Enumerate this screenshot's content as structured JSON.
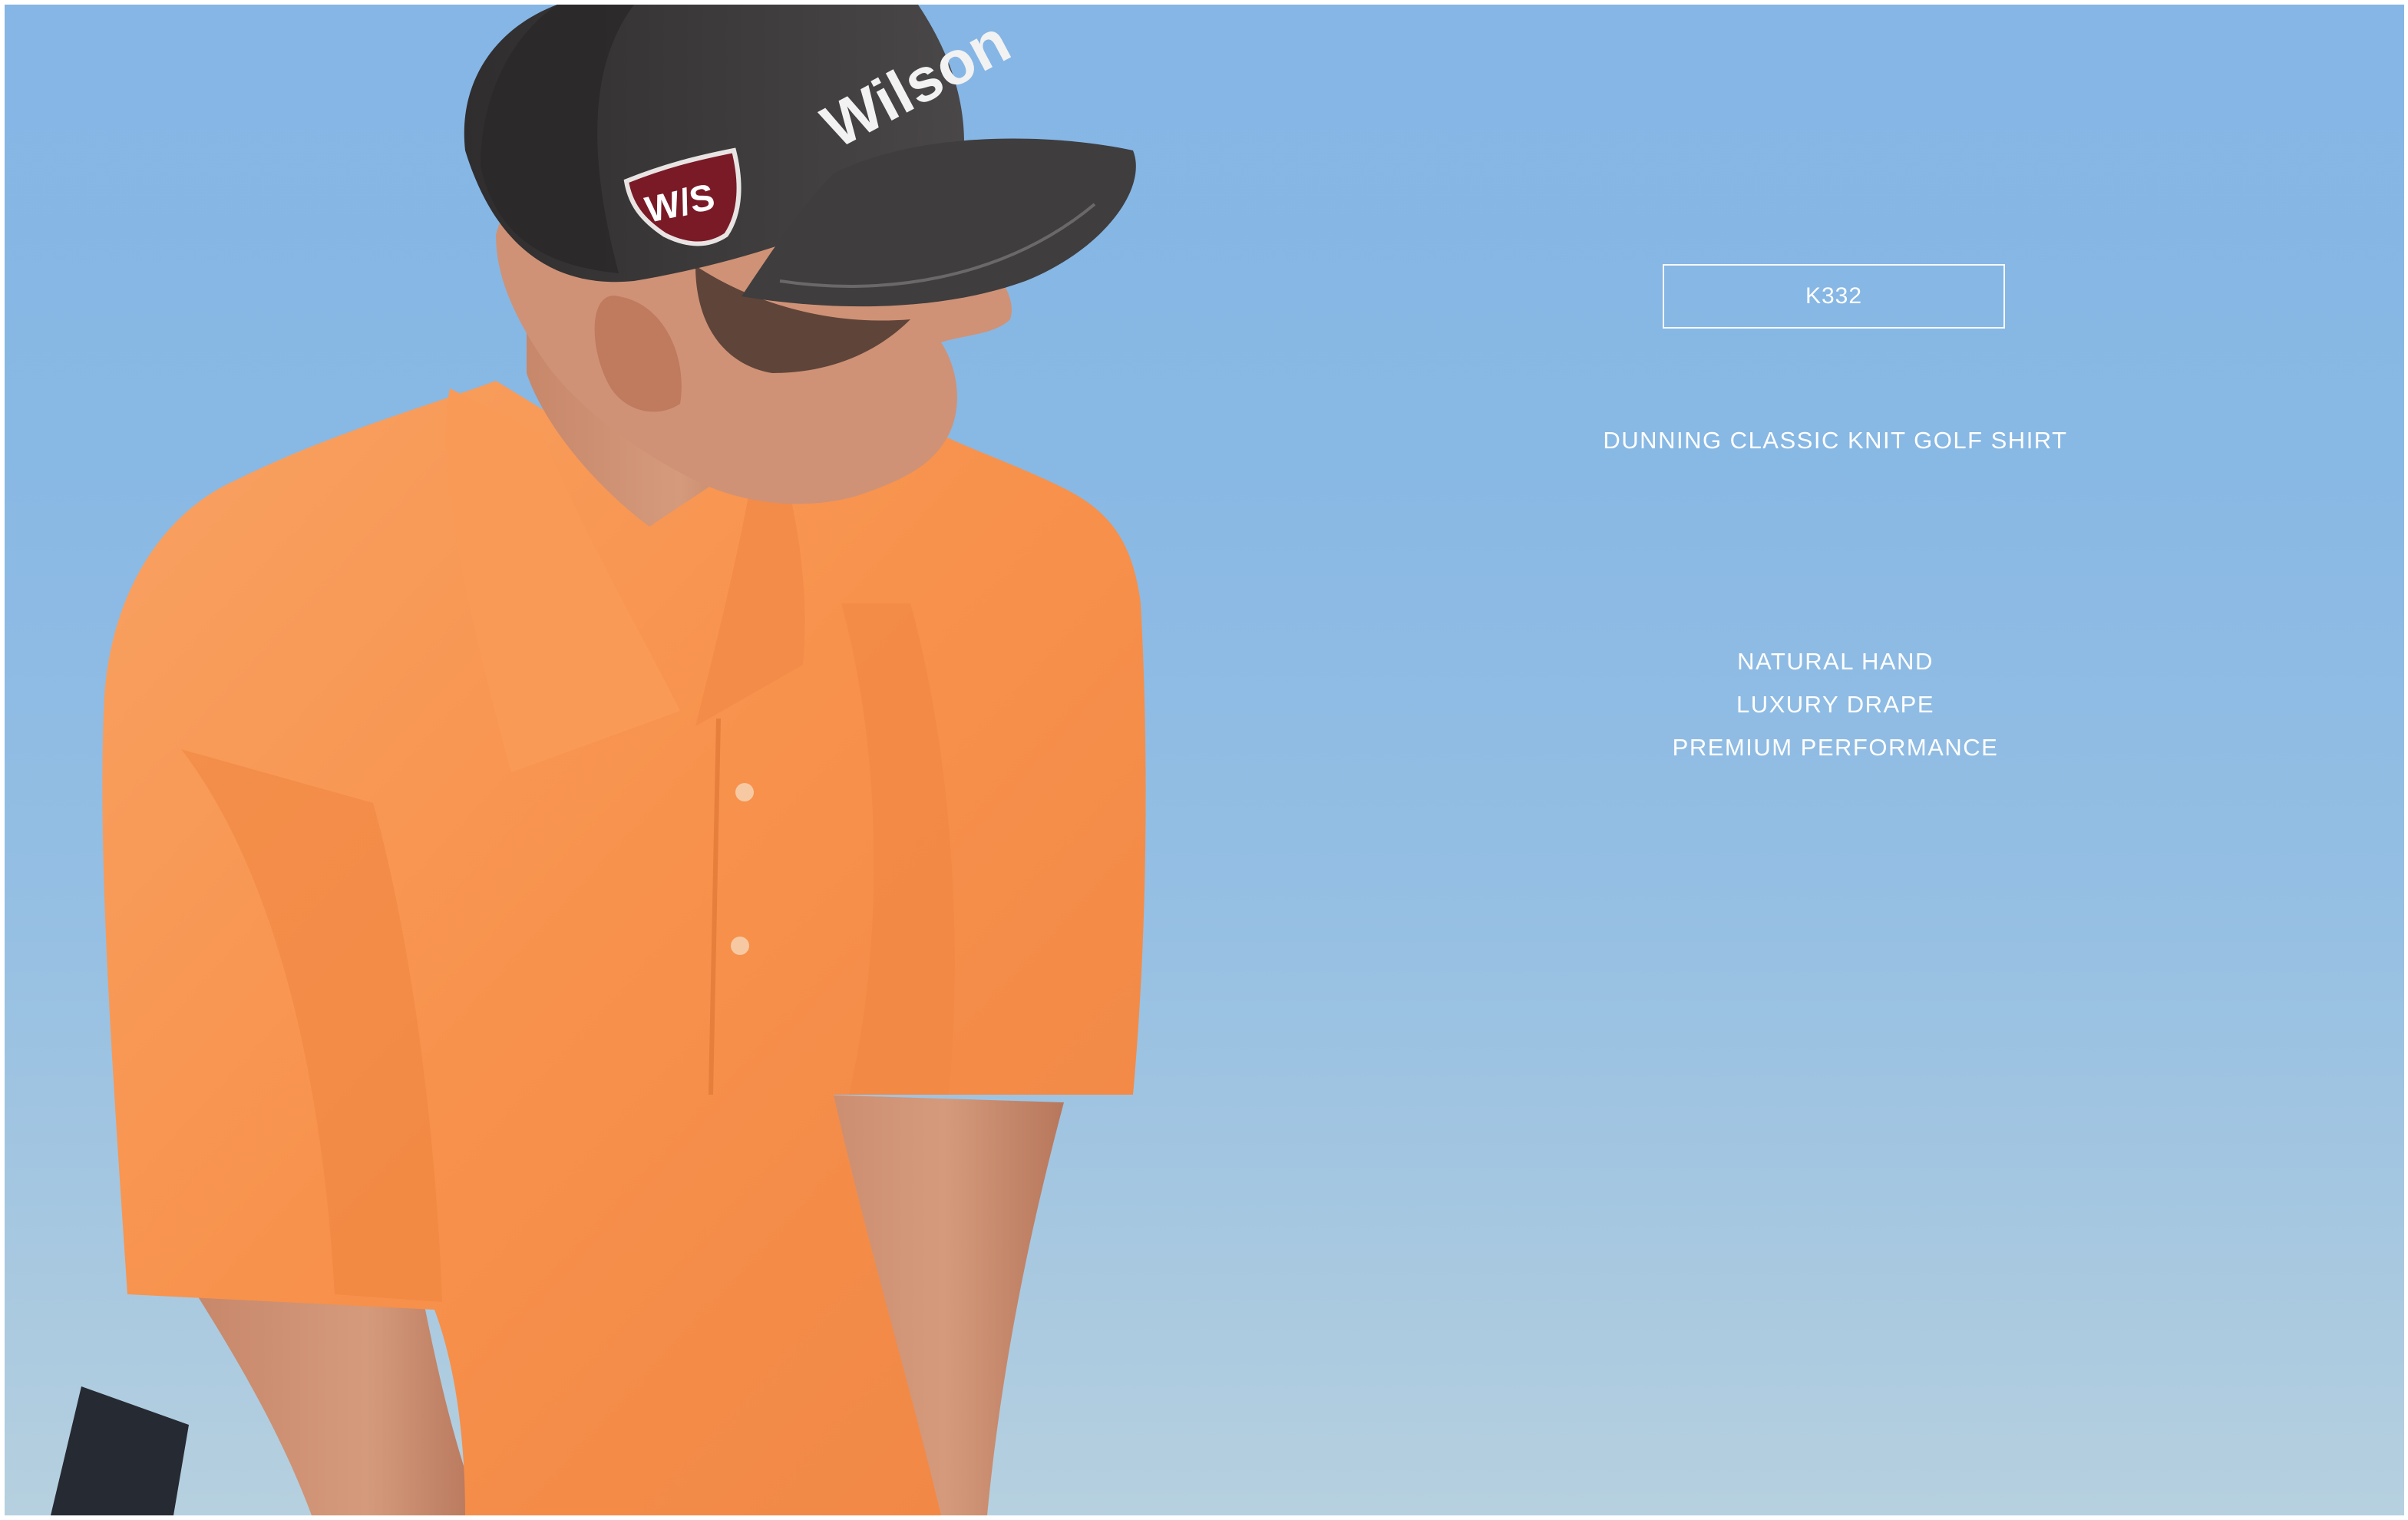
{
  "product": {
    "code": "K332",
    "name": "DUNNING CLASSIC KNIT GOLF SHIRT",
    "features": [
      "NATURAL HAND",
      "LUXURY DRAPE",
      "PREMIUM PERFORMANCE"
    ]
  },
  "photo": {
    "cap_text": "Wilson",
    "logo_text": "W/S",
    "colors": {
      "sky_top": "#85b6e5",
      "sky_bottom": "#b6d0df",
      "shirt": "#f7944f",
      "cap": "#3d3b3c",
      "skin": "#c4876a"
    }
  }
}
